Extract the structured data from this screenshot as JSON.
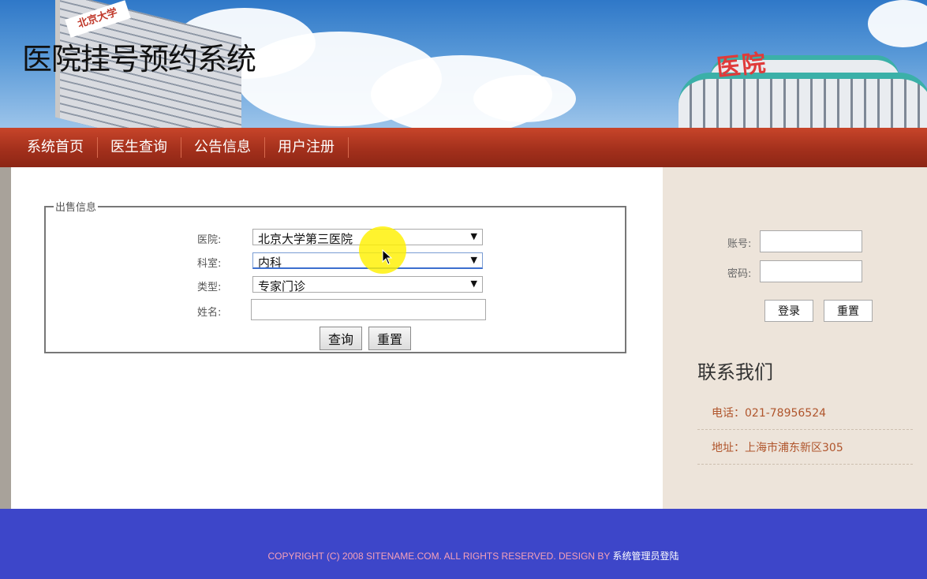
{
  "header": {
    "title": "医院挂号预约系统",
    "hospital_sign": "医院",
    "building_sign": "北京大学"
  },
  "nav": {
    "items": [
      {
        "label": "系统首页"
      },
      {
        "label": "医生查询"
      },
      {
        "label": "公告信息"
      },
      {
        "label": "用户注册"
      }
    ]
  },
  "search_form": {
    "legend": "出售信息",
    "hospital_label": "医院:",
    "hospital_value": "北京大学第三医院",
    "department_label": "科室:",
    "department_value": "内科",
    "type_label": "类型:",
    "type_value": "专家门诊",
    "name_label": "姓名:",
    "name_value": "",
    "search_button": "查询",
    "reset_button": "重置"
  },
  "login": {
    "account_label": "账号:",
    "account_value": "",
    "password_label": "密码:",
    "password_value": "",
    "login_button": "登录",
    "reset_button": "重置"
  },
  "contact": {
    "title": "联系我们",
    "phone": "电话：021-78956524",
    "address": "地址：上海市浦东新区305"
  },
  "footer": {
    "copyright": "COPYRIGHT (C) 2008 SITENAME.COM. ALL RIGHTS RESERVED. DESIGN BY ",
    "admin_link": "系统管理员登陆"
  },
  "colors": {
    "nav_bg": "#a3301c",
    "footer_bg": "#3d46c9",
    "sidebar_bg": "#ede4da",
    "contact_text": "#b0552c",
    "footer_text": "#f5a0b8"
  },
  "icons": {
    "dropdown_arrow": "▼",
    "cursor": "mouse-pointer-icon"
  }
}
